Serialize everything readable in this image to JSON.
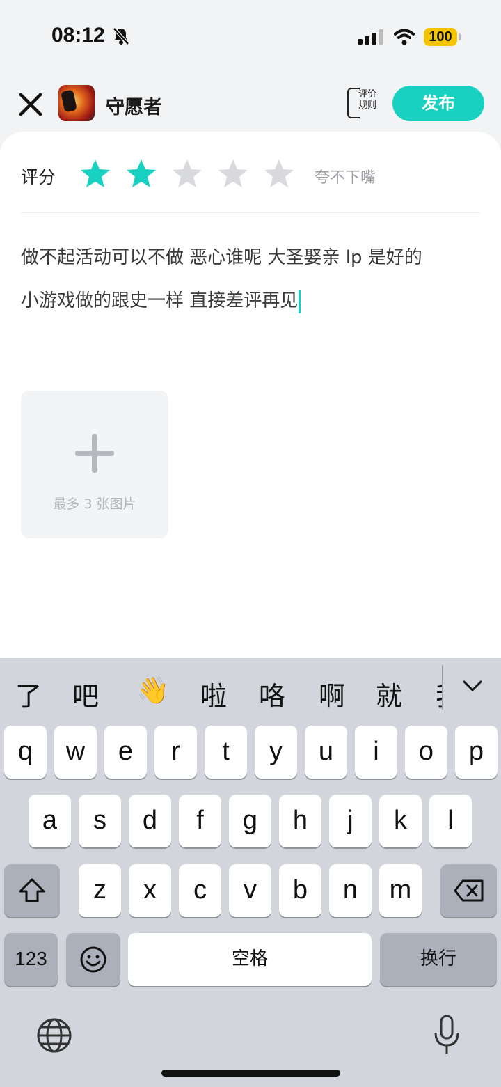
{
  "status_bar": {
    "time": "08:12",
    "battery": "100"
  },
  "header": {
    "app_name": "守愿者",
    "rules_label": "评价规则",
    "publish_label": "发布"
  },
  "rating": {
    "label": "评分",
    "value": 2,
    "max": 5,
    "description": "夸不下嘴",
    "accent_color": "#19d1c0",
    "empty_color": "#d8dadd"
  },
  "review": {
    "line1": "做不起活动可以不做 恶心谁呢 大圣娶亲 lp 是好的",
    "line2": "小游戏做的跟史一样 直接差评再见"
  },
  "upload": {
    "hint": "最多 3 张图片"
  },
  "keyboard": {
    "candidates": [
      "了",
      "吧",
      "👋",
      "啦",
      "咯",
      "啊",
      "就",
      "我"
    ],
    "row1": [
      "q",
      "w",
      "e",
      "r",
      "t",
      "y",
      "u",
      "i",
      "o",
      "p"
    ],
    "row2": [
      "a",
      "s",
      "d",
      "f",
      "g",
      "h",
      "j",
      "k",
      "l"
    ],
    "row3": [
      "z",
      "x",
      "c",
      "v",
      "b",
      "n",
      "m"
    ],
    "numbers_key": "123",
    "emoji_key": "☺",
    "space_key": "空格",
    "return_key": "换行"
  }
}
